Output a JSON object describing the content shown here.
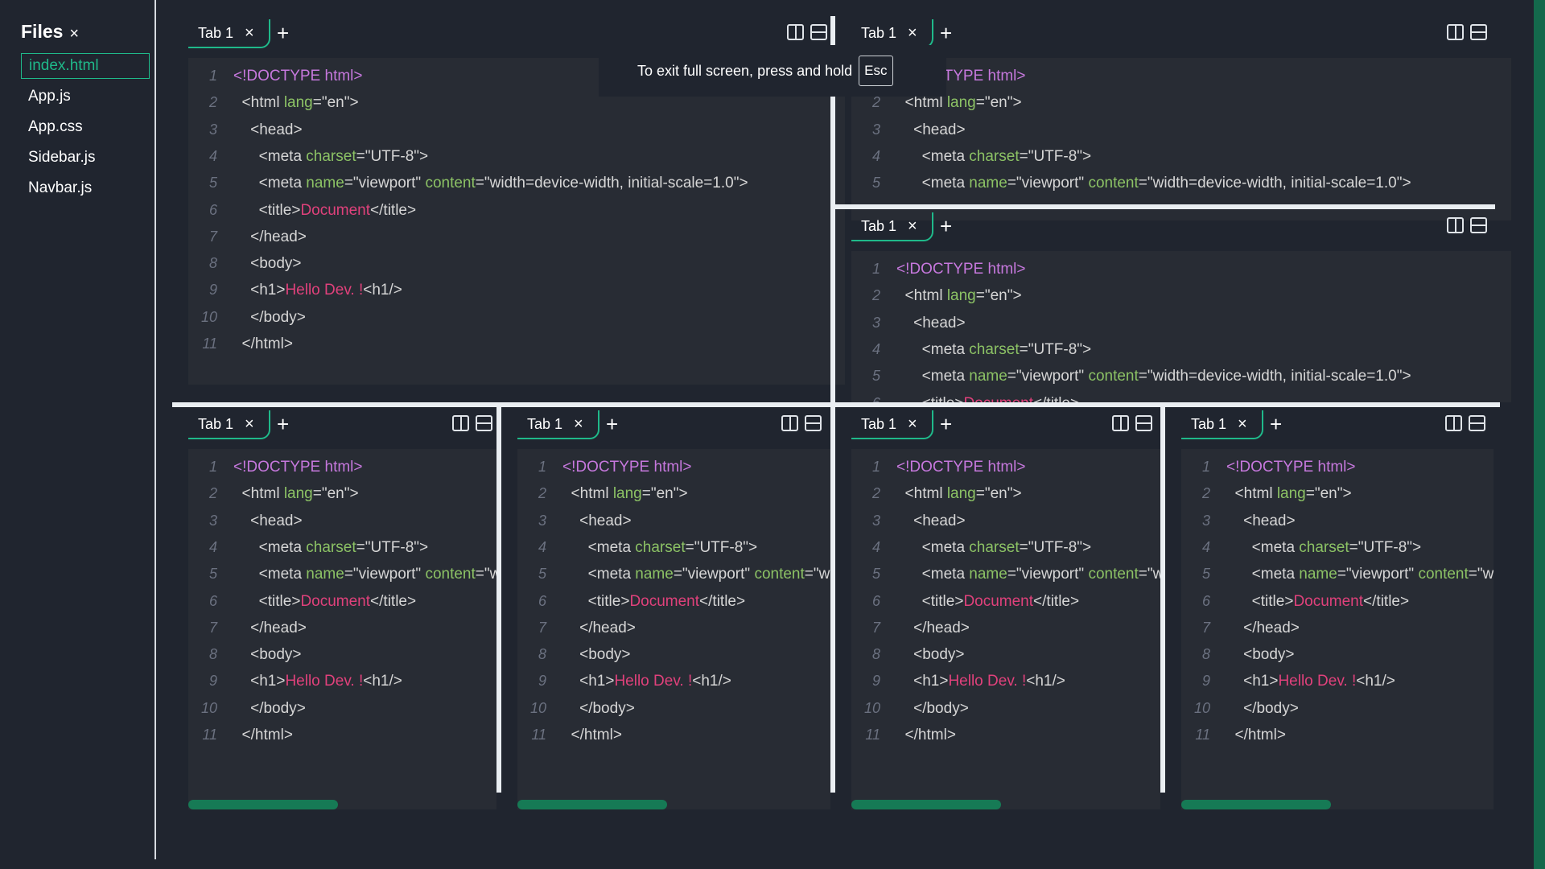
{
  "sidebar": {
    "title": "Files",
    "close_icon": "×",
    "files": [
      {
        "label": "index.html",
        "active": true
      },
      {
        "label": "App.js",
        "active": false
      },
      {
        "label": "App.css",
        "active": false
      },
      {
        "label": "Sidebar.js",
        "active": false
      },
      {
        "label": "Navbar.js",
        "active": false
      }
    ]
  },
  "tab": {
    "label": "Tab 1",
    "close_icon": "×",
    "add_icon": "+"
  },
  "toast": {
    "text": "To exit full screen, press and hold",
    "key": "Esc"
  },
  "code": [
    [
      {
        "t": "<!DOCTYPE html>",
        "c": "kw"
      }
    ],
    [
      {
        "t": "  <html ",
        "c": ""
      },
      {
        "t": "lang",
        "c": "attr"
      },
      {
        "t": "=\"en\">",
        "c": ""
      }
    ],
    [
      {
        "t": "    <head>",
        "c": ""
      }
    ],
    [
      {
        "t": "      <meta ",
        "c": ""
      },
      {
        "t": "charset",
        "c": "attr"
      },
      {
        "t": "=\"UTF-8\">",
        "c": ""
      }
    ],
    [
      {
        "t": "      <meta ",
        "c": ""
      },
      {
        "t": "name",
        "c": "attr"
      },
      {
        "t": "=\"viewport\" ",
        "c": ""
      },
      {
        "t": "content",
        "c": "attr"
      },
      {
        "t": "=\"width=device-width, initial-scale=1.0\">",
        "c": ""
      }
    ],
    [
      {
        "t": "      <title>",
        "c": ""
      },
      {
        "t": "Document",
        "c": "title-txt"
      },
      {
        "t": "</title>",
        "c": ""
      }
    ],
    [
      {
        "t": "    </head>",
        "c": ""
      }
    ],
    [
      {
        "t": "    <body>",
        "c": ""
      }
    ],
    [
      {
        "t": "    <h1>",
        "c": ""
      },
      {
        "t": "Hello Dev. !",
        "c": "title-txt"
      },
      {
        "t": "<h1/>",
        "c": ""
      }
    ],
    [
      {
        "t": "    </body>",
        "c": ""
      }
    ],
    [
      {
        "t": "  </html>",
        "c": ""
      }
    ]
  ],
  "colors": {
    "background": "#20252f",
    "editor": "#282c34",
    "accent": "#1fb98a",
    "scrollbar": "#167a55",
    "keyword": "#c678dd",
    "attribute": "#8cc265",
    "highlight": "#e0417b"
  },
  "icons": [
    "close-icon",
    "add-icon",
    "split-vertical-icon",
    "split-horizontal-icon"
  ]
}
